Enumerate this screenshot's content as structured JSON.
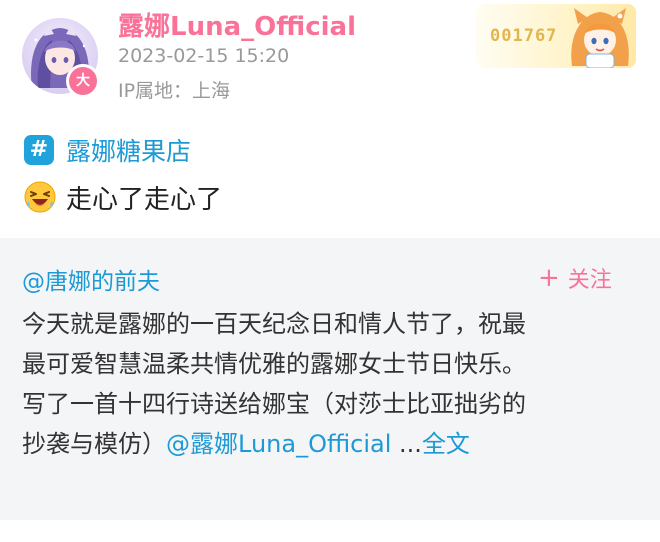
{
  "post": {
    "author": {
      "name": "露娜Luna_Official",
      "badge_char": "大",
      "timestamp": "2023-02-15 15:20",
      "ip_location": "IP属地：上海"
    },
    "fan_badge": {
      "number": "001767"
    },
    "topic": {
      "icon_char": "#",
      "label": "露娜糖果店"
    },
    "text": "走心了走心了",
    "emoji_icon": "laughing-emoji-icon"
  },
  "repost": {
    "author": "@唐娜的前夫",
    "follow_plus": "+",
    "follow_label": "关注",
    "lines": [
      "今天就是露娜的一百天纪念日和情人节了，祝最",
      "最可爱智慧温柔共情优雅的露娜女士节日快乐。",
      "写了一首十四行诗送给娜宝（对莎士比亚拙劣的"
    ],
    "last_line_prefix": "抄袭与模仿）",
    "mention": "@露娜Luna_Official",
    "ellipsis": " ...",
    "read_more": "全文"
  },
  "colors": {
    "brand_pink": "#fb7299",
    "link_blue": "#1d9ad6",
    "topic_blue": "#1fa3da",
    "meta_gray": "#999999",
    "repost_bg": "#f4f5f7"
  }
}
